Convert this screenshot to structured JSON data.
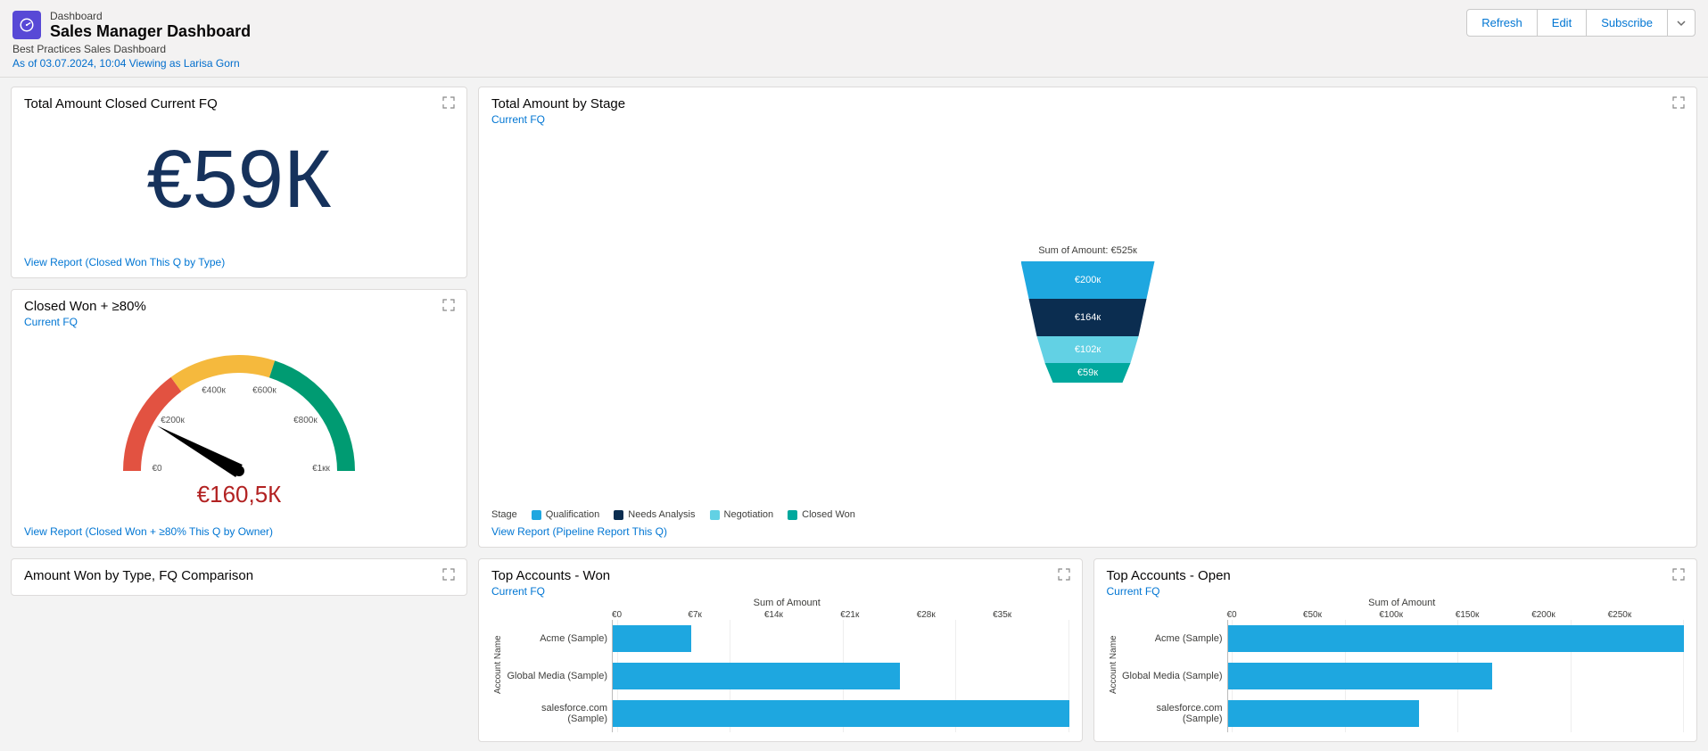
{
  "header": {
    "object_label": "Dashboard",
    "title": "Sales Manager Dashboard",
    "description": "Best Practices Sales Dashboard",
    "meta": "As of 03.07.2024, 10:04 Viewing as Larisa Gorn",
    "actions": {
      "refresh": "Refresh",
      "edit": "Edit",
      "subscribe": "Subscribe"
    }
  },
  "cards": {
    "metric": {
      "title": "Total Amount Closed Current FQ",
      "value": "€59К",
      "report_link": "View Report (Closed Won This Q by Type)"
    },
    "gauge": {
      "title": "Closed Won + ≥80%",
      "subtitle": "Current FQ",
      "value_label": "€160,5К",
      "ticks": [
        "€0",
        "€200к",
        "€400к",
        "€600к",
        "€800к",
        "€1кк"
      ],
      "report_link": "View Report (Closed Won + ≥80% This Q by Owner)"
    },
    "funnel": {
      "title": "Total Amount by Stage",
      "subtitle": "Current FQ",
      "sum_label": "Sum of Amount: €525к",
      "legend_title": "Stage",
      "report_link": "View Report (Pipeline Report This Q)"
    },
    "typecmp": {
      "title": "Amount Won by Type, FQ Comparison"
    },
    "won": {
      "title": "Top Accounts - Won",
      "subtitle": "Current FQ",
      "x_title": "Sum of Amount",
      "y_title": "Account Name"
    },
    "open": {
      "title": "Top Accounts - Open",
      "subtitle": "Current FQ",
      "x_title": "Sum of Amount",
      "y_title": "Account Name"
    }
  },
  "chart_data": {
    "funnel": {
      "type": "funnel",
      "total_label": "Sum of Amount: €525к",
      "stages": [
        {
          "name": "Qualification",
          "label": "€200к",
          "value": 200,
          "color": "#1ea7e0"
        },
        {
          "name": "Needs Analysis",
          "label": "€164к",
          "value": 164,
          "color": "#0b2d50"
        },
        {
          "name": "Negotiation",
          "label": "€102к",
          "value": 102,
          "color": "#62d1e4"
        },
        {
          "name": "Closed Won",
          "label": "€59к",
          "value": 59,
          "color": "#00a89d"
        }
      ]
    },
    "gauge": {
      "type": "gauge",
      "value": 160.5,
      "min": 0,
      "max": 1000,
      "bands": [
        {
          "from": 0,
          "to": 300,
          "color": "#e25241"
        },
        {
          "from": 300,
          "to": 600,
          "color": "#f5b93d"
        },
        {
          "from": 600,
          "to": 1000,
          "color": "#009b72"
        }
      ]
    },
    "top_won": {
      "type": "bar",
      "orientation": "horizontal",
      "xlabel": "Sum of Amount",
      "ylabel": "Account Name",
      "x_ticks": [
        "€0",
        "€7к",
        "€14к",
        "€21к",
        "€28к",
        "€35к"
      ],
      "x_max": 35,
      "series": [
        {
          "name": "Acme (Sample)",
          "value": 6
        },
        {
          "name": "Global Media (Sample)",
          "value": 22
        },
        {
          "name": "salesforce.com (Sample)",
          "value": 36
        }
      ]
    },
    "top_open": {
      "type": "bar",
      "orientation": "horizontal",
      "xlabel": "Sum of Amount",
      "ylabel": "Account Name",
      "x_ticks": [
        "€0",
        "€50к",
        "€100к",
        "€150к",
        "€200к",
        "€250к"
      ],
      "x_max": 250,
      "series": [
        {
          "name": "Acme (Sample)",
          "value": 260
        },
        {
          "name": "Global Media (Sample)",
          "value": 145
        },
        {
          "name": "salesforce.com (Sample)",
          "value": 105
        }
      ]
    }
  }
}
